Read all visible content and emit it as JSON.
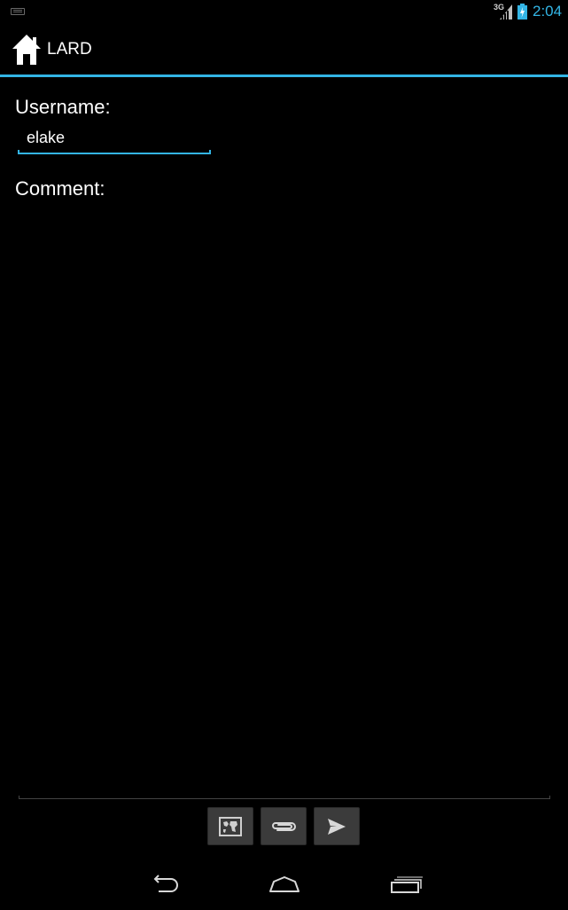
{
  "status_bar": {
    "network_label": "3G",
    "time": "2:04",
    "accent_color": "#33b5e5"
  },
  "action_bar": {
    "title": "LARD",
    "icon": "home-icon"
  },
  "form": {
    "username_label": "Username:",
    "username_value": "elake",
    "comment_label": "Comment:",
    "comment_value": ""
  },
  "toolbar": {
    "buttons": [
      {
        "icon": "map-icon"
      },
      {
        "icon": "paperclip-icon"
      },
      {
        "icon": "send-icon"
      }
    ]
  },
  "nav_bar": {
    "buttons": [
      {
        "icon": "back-icon"
      },
      {
        "icon": "home-nav-icon"
      },
      {
        "icon": "recent-apps-icon"
      }
    ]
  }
}
